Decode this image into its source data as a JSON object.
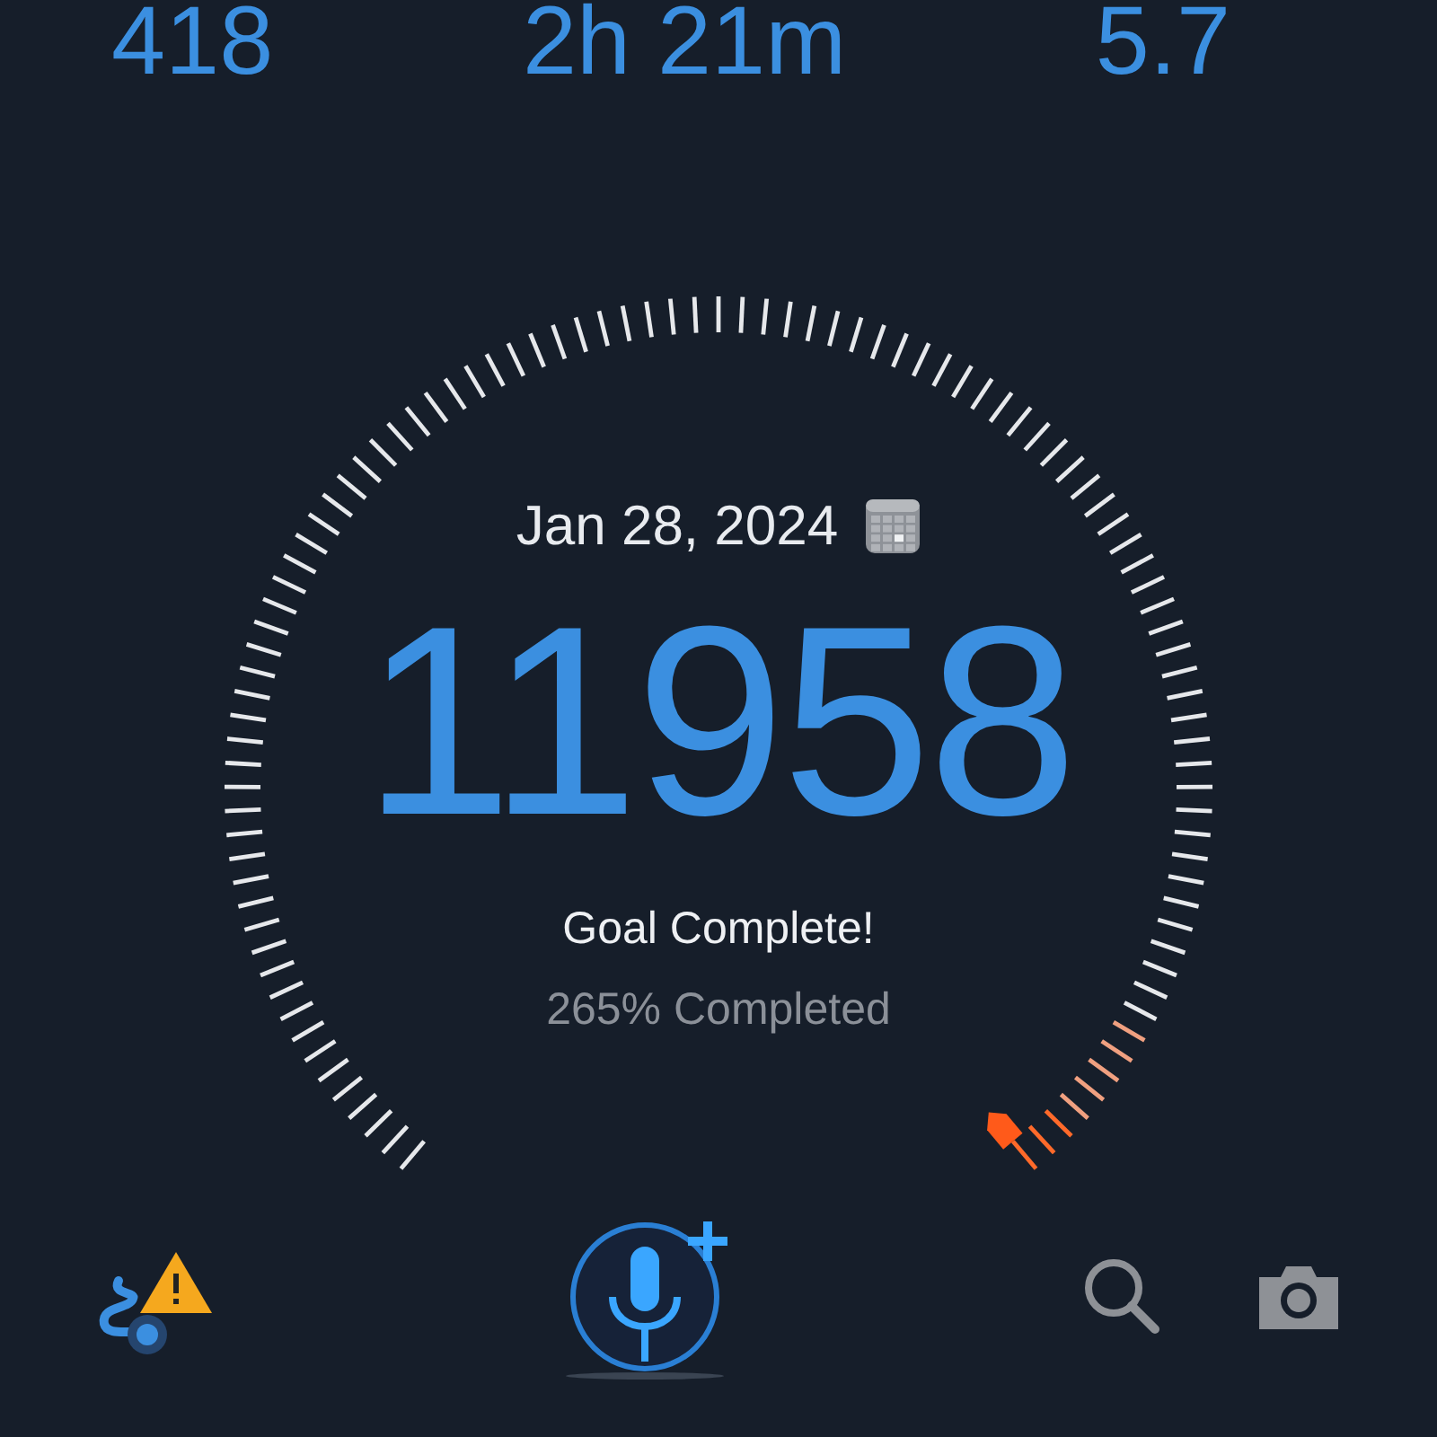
{
  "stats": [
    "418",
    "2h 21m",
    "5.7"
  ],
  "gauge": {
    "date": "Jan 28, 2024",
    "steps": "11958",
    "status": "Goal Complete!",
    "progress": "265% Completed"
  },
  "toolbar": {
    "route_warning": true
  }
}
